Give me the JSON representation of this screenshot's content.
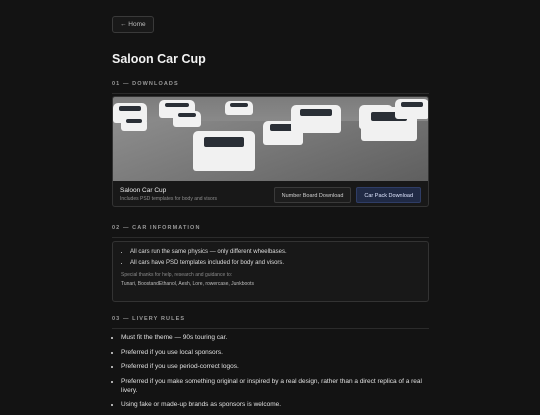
{
  "nav": {
    "home_label": "← Home"
  },
  "page": {
    "title": "Saloon Car Cup"
  },
  "downloads": {
    "section_title": "01 — DOWNLOADS",
    "pack_name": "Saloon Car Cup",
    "pack_subtitle": "Includes PSD templates for body and visors",
    "number_board_label": "Number Board Download",
    "car_pack_label": "Car Pack Download"
  },
  "car_info": {
    "section_title": "02 — CAR INFORMATION",
    "items": [
      "All cars run the same physics — only different wheelbases.",
      "All cars have PSD templates included for body and visors."
    ],
    "thanks_label": "Special thanks for help, research and guidance to:",
    "thanks_names": "Tunari, BoostandEthanol, Aesh, Lore, rowercase, Junkboots"
  },
  "livery_rules": {
    "section_title": "03 — LIVERY RULES",
    "items": [
      "Must fit the theme — 90s touring car.",
      "Preferred if you use local sponsors.",
      "Preferred if you use period-correct logos.",
      "Preferred if you make something original or inspired by a real design, rather than a direct replica of a real livery.",
      "Using fake or made-up brands as sponsors is welcome."
    ]
  }
}
